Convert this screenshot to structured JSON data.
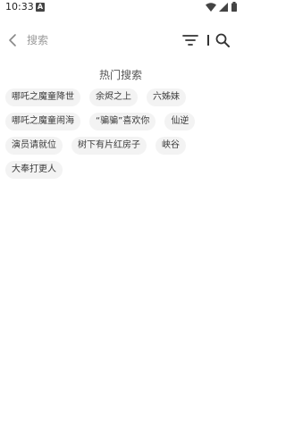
{
  "status_bar": {
    "time": "10:33",
    "notification_letter": "A"
  },
  "search": {
    "placeholder": "搜索"
  },
  "hot": {
    "title": "热门搜索",
    "tags": [
      "哪吒之魔童降世",
      "余烬之上",
      "六姊妹",
      "哪吒之魔童闹海",
      "“骗骗”喜欢你",
      "仙逆",
      "演员请就位",
      "树下有片红房子",
      "峡谷",
      "大奉打更人"
    ]
  }
}
